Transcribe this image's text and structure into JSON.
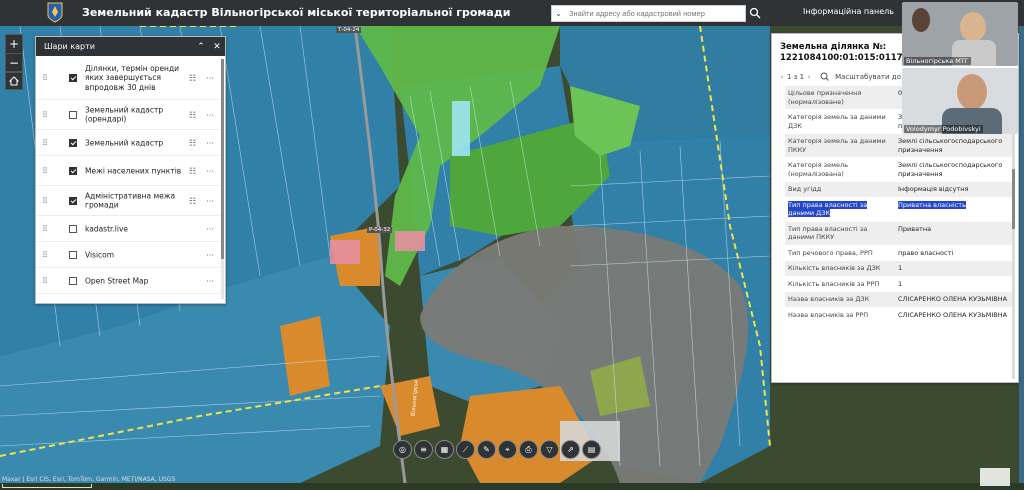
{
  "header": {
    "title": "Земельний кадастр Вільногірської міської територіальної громади",
    "search": {
      "value": "",
      "placeholder": "Знайти адресу або кадастровий номер"
    },
    "info_panel_label": "Інформаційна панель"
  },
  "map_labels": {
    "road_label_1": "Вільногірськ",
    "road_label_2": "Т-04-24",
    "road_label_3": "Р-04-32"
  },
  "layers_panel": {
    "title": "Шари карти",
    "items": [
      {
        "label": "Ділянки, термін оренди яких завершується впродовж 30 днів",
        "checked": true
      },
      {
        "label": "Земельний кадастр (орендарі)",
        "checked": false
      },
      {
        "label": "Земельний кадастр",
        "checked": true
      },
      {
        "label": "Межі населених пунктів",
        "checked": true
      },
      {
        "label": "Адміністративна межа громади",
        "checked": true
      },
      {
        "label": "kadastr.live",
        "checked": false
      },
      {
        "label": "Visicom",
        "checked": false
      },
      {
        "label": "Open Street Map",
        "checked": false
      }
    ]
  },
  "info_panel": {
    "title": "Земельна ділянка №: 1221084100:01:015:0117",
    "pager": "1 з 1",
    "zoom_label": "Масштабувати до",
    "rows": [
      {
        "key": "Цільове призначення (нормалізоване)",
        "value": "01"
      },
      {
        "key": "Категорія земель за даними ДЗК",
        "value": "Землі сільськогосподарського призначення"
      },
      {
        "key": "Категорія земель за даними ПККУ",
        "value": "Землі сільськогосподарського призначення"
      },
      {
        "key": "Категорія земель (нормалізована)",
        "value": "Землі сільськогосподарського призначення"
      },
      {
        "key": "Вид угідд",
        "value": "Інформація відсутня"
      },
      {
        "key": "Тип права власності за даними ДЗК",
        "value": "Приватна власність"
      },
      {
        "key": "Тип права власності за даними ПККУ",
        "value": "Приватна"
      },
      {
        "key": "Тип речового права, РРП",
        "value": "право власності"
      },
      {
        "key": "Кількість власників за ДЗК",
        "value": "1"
      },
      {
        "key": "Кількість власників за РРП",
        "value": "1"
      },
      {
        "key": "Назва власників за ДЗК",
        "value": "СЛІСАРЕНКО ОЛЕНА КУЗЬМІВНА"
      },
      {
        "key": "Назва власників за РРП",
        "value": "СЛІСАРЕНКО ОЛЕНА КУЗЬМІВНА"
      }
    ]
  },
  "video": {
    "participant_1": "Вільногірська МТГ",
    "participant_2": "Volodymyr Podobivskyi"
  },
  "attribution": "Maxar | Esri CIS, Esri, TomTom, Garmin, METI/NASA, USGS",
  "colors": {
    "header_bg": "#2f3336",
    "parcel_blue": "#2f86b6",
    "green_zone": "#5fb84a",
    "orange_zone": "#d98a2c",
    "highlight": "#2447c9"
  }
}
